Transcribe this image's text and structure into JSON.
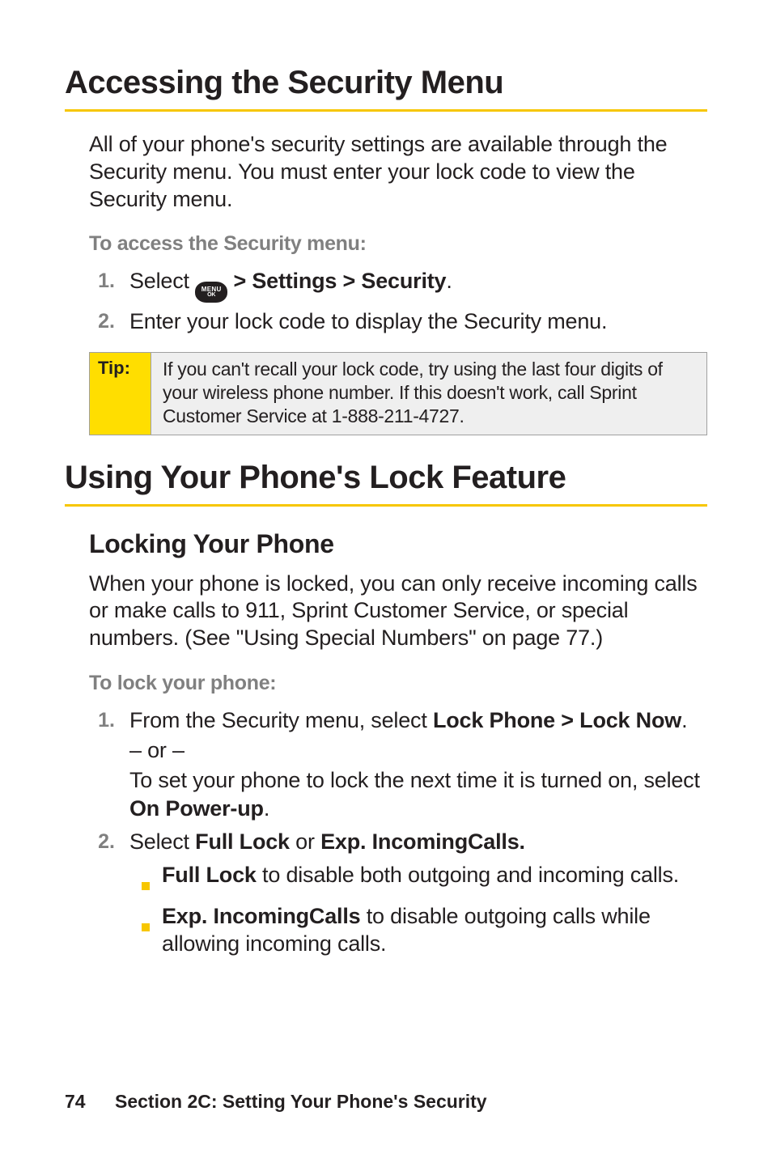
{
  "section1": {
    "title": "Accessing the Security Menu",
    "intro": "All of your phone's security settings are available through the Security menu. You must enter your lock code to view the Security menu.",
    "lead": "To access the Security menu:",
    "steps": {
      "n1": "1.",
      "s1_pre": "Select ",
      "menu_icon_top": "MENU",
      "menu_icon_bottom": "OK",
      "s1_bold": " > Settings > Security",
      "s1_post": ".",
      "n2": "2.",
      "s2": "Enter your lock code to display the Security menu."
    },
    "tip_label": "Tip:",
    "tip_body": "If you can't recall your lock code, try using the last four digits of your wireless phone number. If this doesn't work, call Sprint Customer Service at 1-888-211-4727."
  },
  "section2": {
    "title": "Using Your Phone's Lock Feature",
    "subtitle": "Locking Your Phone",
    "intro": "When your phone is locked, you can only receive incoming calls or make calls to 911, Sprint Customer Service, or special numbers. (See \"Using Special Numbers\" on page 77.)",
    "lead": "To lock your phone:",
    "steps": {
      "n1": "1.",
      "s1_pre": "From the Security menu, select ",
      "s1_bold": "Lock Phone > Lock Now",
      "s1_post": ".",
      "s1_or": "– or –",
      "s1_line2_pre": "To set your phone to lock the next time it is turned on, select ",
      "s1_line2_bold": "On Power-up",
      "s1_line2_post": ".",
      "n2": "2.",
      "s2_pre": "Select ",
      "s2_bold1": "Full Lock",
      "s2_mid": " or ",
      "s2_bold2": "Exp. IncomingCalls.",
      "b1_bold": "Full Lock",
      "b1_rest": " to disable both outgoing and incoming calls.",
      "b2_bold": "Exp. IncomingCalls",
      "b2_rest": " to disable outgoing calls while allowing incoming calls."
    }
  },
  "footer": {
    "page": "74",
    "text": "Section 2C: Setting Your Phone's Security"
  }
}
